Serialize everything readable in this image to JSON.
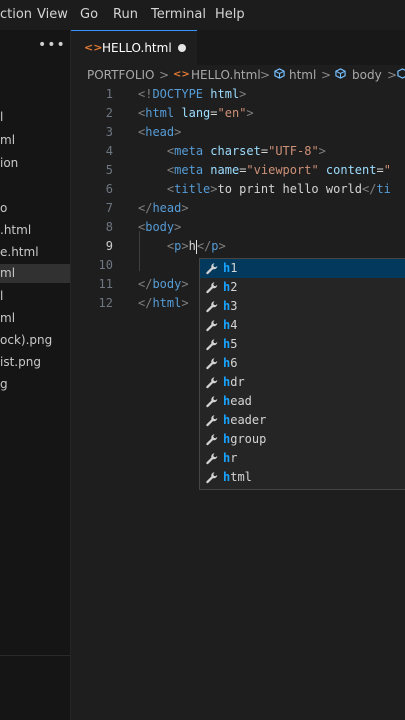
{
  "menubar": {
    "items": [
      "ction",
      "View",
      "Go",
      "Run",
      "Terminal",
      "Help"
    ]
  },
  "explorer": {
    "more_icon": "ellipsis-icon",
    "files": [
      "l",
      "ml",
      "ion",
      "",
      "o",
      ".html",
      "e.html",
      "ml",
      "l",
      "ml",
      "ock).png",
      "ist.png",
      "g"
    ],
    "selected_index": 7
  },
  "tab": {
    "label": "HELLO.html",
    "icon": "html-file-icon",
    "modified": true
  },
  "breadcrumb": {
    "folder": "PORTFOLIO",
    "file": "HELLO.html",
    "sym1": "html",
    "sym2": "body"
  },
  "editor": {
    "active_line": 9,
    "line_numbers": [
      "1",
      "2",
      "3",
      "4",
      "5",
      "6",
      "7",
      "8",
      "9",
      "10",
      "11",
      "12"
    ],
    "lines": [
      [
        [
          "t-br",
          "<!"
        ],
        [
          "t-doc",
          "DOCTYPE"
        ],
        [
          "t-txt",
          " "
        ],
        [
          "t-attr",
          "html"
        ],
        [
          "t-br",
          ">"
        ]
      ],
      [
        [
          "t-br",
          "<"
        ],
        [
          "t-tag",
          "html"
        ],
        [
          "t-txt",
          " "
        ],
        [
          "t-attr",
          "lang"
        ],
        [
          "t-txt",
          "="
        ],
        [
          "t-str",
          "\"en\""
        ],
        [
          "t-br",
          ">"
        ]
      ],
      [
        [
          "t-br",
          "<"
        ],
        [
          "t-tag",
          "head"
        ],
        [
          "t-br",
          ">"
        ]
      ],
      [
        [
          "t-txt",
          "    "
        ],
        [
          "t-br",
          "<"
        ],
        [
          "t-tag",
          "meta"
        ],
        [
          "t-txt",
          " "
        ],
        [
          "t-attr",
          "charset"
        ],
        [
          "t-txt",
          "="
        ],
        [
          "t-str",
          "\"UTF-8\""
        ],
        [
          "t-br",
          ">"
        ]
      ],
      [
        [
          "t-txt",
          "    "
        ],
        [
          "t-br",
          "<"
        ],
        [
          "t-tag",
          "meta"
        ],
        [
          "t-txt",
          " "
        ],
        [
          "t-attr",
          "name"
        ],
        [
          "t-txt",
          "="
        ],
        [
          "t-str",
          "\"viewport\""
        ],
        [
          "t-txt",
          " "
        ],
        [
          "t-attr",
          "content"
        ],
        [
          "t-txt",
          "="
        ],
        [
          "t-str",
          "\""
        ]
      ],
      [
        [
          "t-txt",
          "    "
        ],
        [
          "t-br",
          "<"
        ],
        [
          "t-tag",
          "title"
        ],
        [
          "t-br",
          ">"
        ],
        [
          "t-txt",
          "to print hello world"
        ],
        [
          "t-br",
          "</"
        ],
        [
          "t-tag",
          "ti"
        ]
      ],
      [
        [
          "t-br",
          "</"
        ],
        [
          "t-tag",
          "head"
        ],
        [
          "t-br",
          ">"
        ]
      ],
      [
        [
          "t-br",
          "<"
        ],
        [
          "t-tag",
          "body"
        ],
        [
          "t-br",
          ">"
        ]
      ],
      [
        [
          "t-txt",
          "    "
        ],
        [
          "t-br",
          "<"
        ],
        [
          "t-tag",
          "p"
        ],
        [
          "t-br",
          ">"
        ],
        [
          "t-txt",
          "h"
        ],
        [
          "cursor",
          ""
        ],
        [
          "t-br",
          "</"
        ],
        [
          "t-tag",
          "p"
        ],
        [
          "t-br",
          ">"
        ]
      ],
      [],
      [
        [
          "t-br",
          "</"
        ],
        [
          "t-tag",
          "body"
        ],
        [
          "t-br",
          ">"
        ]
      ],
      [
        [
          "t-br",
          "</"
        ],
        [
          "t-tag",
          "html"
        ],
        [
          "t-br",
          ">"
        ]
      ]
    ]
  },
  "suggestions": {
    "icon": "wrench-icon",
    "selected_index": 0,
    "items": [
      "h1",
      "h2",
      "h3",
      "h4",
      "h5",
      "h6",
      "hdr",
      "head",
      "header",
      "hgroup",
      "hr",
      "html"
    ]
  },
  "colors": {
    "accent": "#3794ff",
    "highlight": "#18a3ff",
    "tag": "#569cd6",
    "string": "#ce9178",
    "attribute": "#9cdcfe"
  }
}
